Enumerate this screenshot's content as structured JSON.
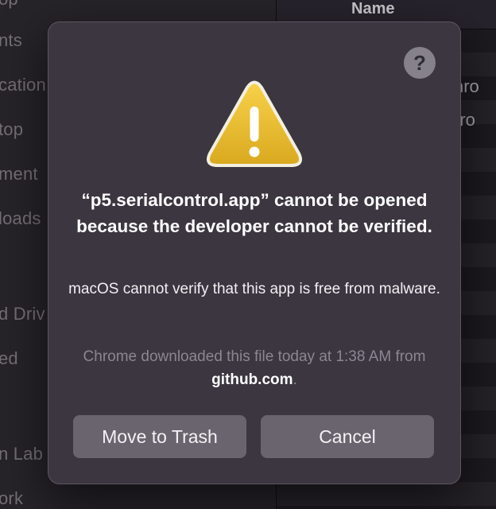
{
  "background": {
    "sidebar_items": [
      "op",
      "nts",
      "cation",
      "top",
      "ment",
      "loads",
      "d Driv",
      "ed",
      "n Lab",
      "ork"
    ],
    "column_header": "Name",
    "file_names": [
      "chro",
      "ntro"
    ]
  },
  "dialog": {
    "help_label": "?",
    "title": "“p5.serialcontrol.app” cannot be opened because the developer cannot be verified.",
    "message": "macOS cannot verify that this app is free from malware.",
    "download_prefix": "Chrome downloaded this file today at 1:38 AM from ",
    "download_source": "github.com",
    "download_suffix": ".",
    "buttons": {
      "trash": "Move to Trash",
      "cancel": "Cancel"
    }
  },
  "colors": {
    "dialog_bg": "#3b3640",
    "button_bg": "#69646e",
    "warning_yellow": "#f1c232"
  },
  "icons": {
    "warning": "warning-triangle-icon",
    "help": "help-icon"
  }
}
